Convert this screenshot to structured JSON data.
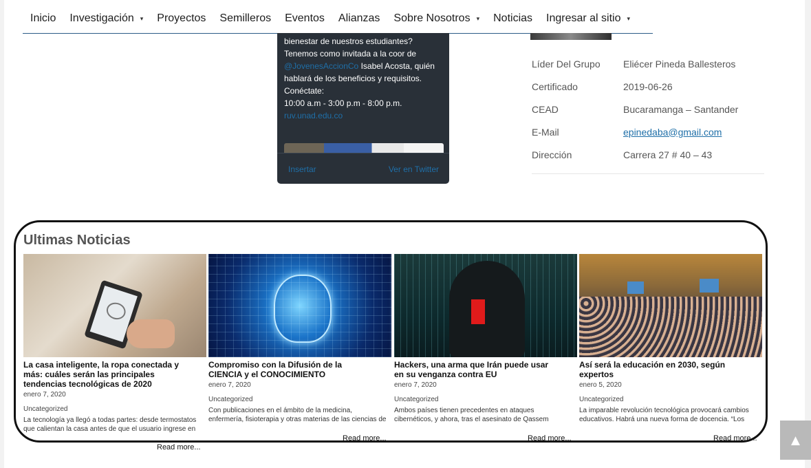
{
  "nav": {
    "items": [
      {
        "label": "Inicio",
        "dropdown": false
      },
      {
        "label": "Investigación",
        "dropdown": true
      },
      {
        "label": "Proyectos",
        "dropdown": false
      },
      {
        "label": "Semilleros",
        "dropdown": false
      },
      {
        "label": "Eventos",
        "dropdown": false
      },
      {
        "label": "Alianzas",
        "dropdown": false
      },
      {
        "label": "Sobre Nosotros",
        "dropdown": true
      },
      {
        "label": "Noticias",
        "dropdown": false
      },
      {
        "label": "Ingresar al sitio",
        "dropdown": true
      }
    ],
    "caret": "▾"
  },
  "tweet": {
    "line1": "bienestar de nuestros estudiantes?",
    "line2": "Tenemos como invitada a la coor de",
    "mention": "@JovenesAccionCo",
    "line3_rest": " Isabel Acosta, quién",
    "line4": "hablará de los beneficios y requisitos.",
    "line5": "Conéctate:",
    "line6": "10:00 a.m - 3:00 p.m - 8:00 p.m.",
    "link": "ruv.unad.edu.co",
    "embed_label": "Insertar",
    "view_label": "Ver en Twitter"
  },
  "group_info": {
    "rows": [
      {
        "label": "Líder Del Grupo",
        "value": "Eliécer Pineda Ballesteros"
      },
      {
        "label": "Certificado",
        "value": "2019-06-26"
      },
      {
        "label": "CEAD",
        "value": "Bucaramanga –  Santander"
      },
      {
        "label": "E-Mail",
        "value": "epinedaba@gmail.com"
      },
      {
        "label": "Dirección",
        "value": "Carrera 27 # 40 – 43"
      }
    ]
  },
  "news": {
    "heading": "Ultimas Noticias",
    "read_more": "Read more...",
    "cards": [
      {
        "title": "La casa inteligente, la ropa conectada y más: cuáles serán las principales tendencias tecnológicas de 2020",
        "date": "enero 7, 2020",
        "category": "Uncategorized",
        "excerpt1": "La tecnología ya llegó a todas partes: desde termostatos",
        "excerpt2": "que calientan la casa antes de que el usuario ingrese en"
      },
      {
        "title": "Compromiso con la Difusión de la CIENCIA y el CONOCIMIENTO",
        "date": "enero 7, 2020",
        "category": "Uncategorized",
        "excerpt1": "Con publicaciones en el ámbito de la medicina,",
        "excerpt2": "enfermería, fisioterapia y otras materias de las ciencias de"
      },
      {
        "title": "Hackers, una arma que Irán puede usar en su venganza contra EU",
        "date": "enero 7, 2020",
        "category": "Uncategorized",
        "excerpt1": "Ambos países tienen precedentes en ataques",
        "excerpt2": "cibernéticos, y ahora, tras el asesinato de Qassem"
      },
      {
        "title": "Así será la educación en 2030, según expertos",
        "date": "enero 5, 2020",
        "category": "Uncategorized",
        "excerpt1": "La imparable revolución tecnológica provocará cambios",
        "excerpt2": "educativos. Habrá una nueva forma de docencia. “Los"
      }
    ]
  },
  "scroll_top_icon": "▲"
}
